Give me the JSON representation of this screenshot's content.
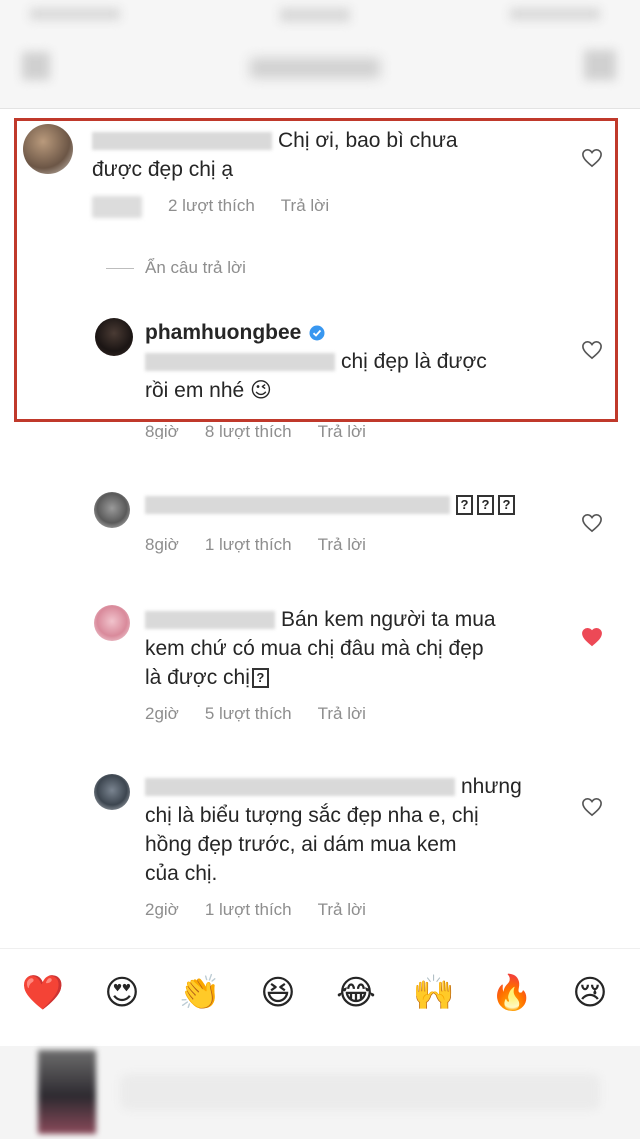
{
  "comments": [
    {
      "text_line1": "Chị ơi, bao bì chưa",
      "text_line2": "được đẹp chị ạ",
      "likes": "2 lượt thích",
      "reply": "Trả lời"
    },
    {
      "hide_replies": "Ẩn câu trả lời"
    },
    {
      "username": "phamhuongbee",
      "verified": true,
      "text_line1": "chị đẹp là được",
      "text_line2": "rồi em nhé 😉",
      "time": "8giờ",
      "likes": "8 lượt thích",
      "reply": "Trả lời"
    },
    {
      "text_line1": "???",
      "time": "8giờ",
      "likes": "1 lượt thích",
      "reply": "Trả lời"
    },
    {
      "text_line1": "Bán kem người ta mua",
      "text_line2": "kem chứ có mua chị đâu mà chị đẹp",
      "text_line3": "là được chị",
      "time": "2giờ",
      "likes": "5 lượt thích",
      "reply": "Trả lời",
      "liked": true
    },
    {
      "text_line1": "nhưng",
      "text_line2": "chị là biểu tượng sắc đẹp nha e, chị",
      "text_line3": "hồng đẹp trước, ai dám mua kem",
      "text_line4": "của chị.",
      "time": "2giờ",
      "likes": "1 lượt thích",
      "reply": "Trả lời"
    }
  ],
  "reactions": [
    "❤️",
    "😍",
    "👏",
    "😆",
    "😂",
    "🙌",
    "🔥",
    "😢"
  ],
  "colors": {
    "highlight": "#c0392b",
    "liked_heart": "#ed4956",
    "verified": "#3897f0",
    "meta": "#8e8e8e"
  }
}
